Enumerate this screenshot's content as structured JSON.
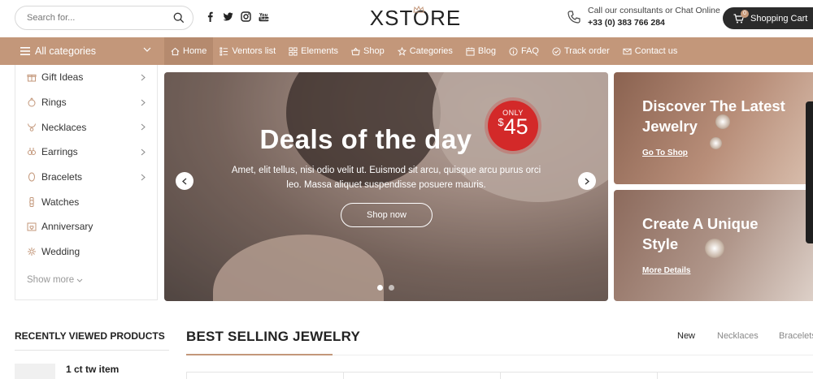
{
  "search": {
    "placeholder": "Search for..."
  },
  "social": [
    "facebook-icon",
    "twitter-icon",
    "instagram-icon",
    "youtube-icon"
  ],
  "logo": {
    "text": "XSTORE"
  },
  "contact": {
    "line1": "Call our consultants or Chat Online",
    "phone": "+33 (0) 383 766 284"
  },
  "cart": {
    "label": "Shopping Cart",
    "count": "0"
  },
  "nav": {
    "all_categories": "All categories",
    "items": [
      {
        "label": "Home",
        "icon": "home-icon"
      },
      {
        "label": "Ventors list",
        "icon": "list-icon"
      },
      {
        "label": "Elements",
        "icon": "grid-icon"
      },
      {
        "label": "Shop",
        "icon": "basket-icon"
      },
      {
        "label": "Categories",
        "icon": "star-icon"
      },
      {
        "label": "Blog",
        "icon": "calendar-icon"
      },
      {
        "label": "FAQ",
        "icon": "info-icon"
      },
      {
        "label": "Track order",
        "icon": "check-circle-icon"
      },
      {
        "label": "Contact us",
        "icon": "mail-icon"
      }
    ]
  },
  "categories": [
    {
      "label": "Gift Ideas",
      "has_sub": true
    },
    {
      "label": "Rings",
      "has_sub": true
    },
    {
      "label": "Necklaces",
      "has_sub": true
    },
    {
      "label": "Earrings",
      "has_sub": true
    },
    {
      "label": "Bracelets",
      "has_sub": true
    },
    {
      "label": "Watches",
      "has_sub": false
    },
    {
      "label": "Anniversary",
      "has_sub": false
    },
    {
      "label": "Wedding",
      "has_sub": false
    }
  ],
  "show_more": "Show more",
  "hero": {
    "title": "Deals of the day",
    "price_badge": {
      "only": "ONLY",
      "currency": "$",
      "amount": "45"
    },
    "description": "Amet, elit tellus, nisi odio velit ut. Euismod sit arcu, quisque arcu purus orci leo. Massa aliquet suspendisse posuere mauris.",
    "button": "Shop now",
    "slides": 2,
    "active_slide": 1
  },
  "promos": [
    {
      "title": "Discover The Latest Jewelry",
      "link": "Go To Shop"
    },
    {
      "title": "Create A Unique Style",
      "link": "More Details"
    }
  ],
  "recent": {
    "title": "RECENTLY VIEWED PRODUCTS",
    "item": "1 ct tw item"
  },
  "best": {
    "title": "BEST SELLING JEWELRY",
    "tabs": [
      {
        "label": "New",
        "active": true
      },
      {
        "label": "Necklaces",
        "active": false
      },
      {
        "label": "Bracelets",
        "active": false
      }
    ]
  },
  "colors": {
    "accent": "#c3977a",
    "accent_dark": "#b58a6e",
    "badge": "#d32929",
    "cart_bg": "#2b2b2b"
  }
}
